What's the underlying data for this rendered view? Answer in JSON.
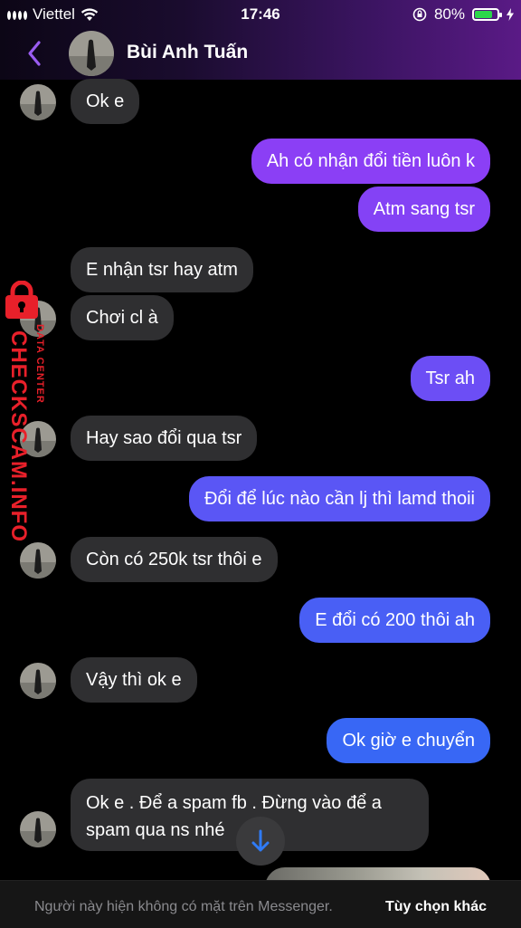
{
  "status_bar": {
    "carrier": "Viettel",
    "time": "17:46",
    "battery_percent": "80%",
    "battery_level": 0.8,
    "battery_color": "#2bd64a"
  },
  "header": {
    "back_icon": "chevron-left-icon",
    "contact_name": "Bùi Anh Tuấn"
  },
  "colors": {
    "incoming_bubble": "#2f2f31",
    "outgoing_gradient_top": "#8b3ff5",
    "outgoing_gradient_bottom": "#2f6bf5",
    "accent": "#9a5cf0"
  },
  "messages": [
    {
      "dir": "in",
      "text": "Ok e"
    },
    {
      "dir": "out",
      "text": "Ah có nhận đổi tiền luôn k"
    },
    {
      "dir": "out",
      "text": "Atm sang tsr"
    },
    {
      "dir": "in",
      "text": "E nhận tsr hay atm"
    },
    {
      "dir": "in",
      "text": "Chơi cl à"
    },
    {
      "dir": "out",
      "text": "Tsr ah"
    },
    {
      "dir": "in",
      "text": "Hay sao đổi qua tsr"
    },
    {
      "dir": "out",
      "text": "Đổi để lúc nào cần lj thì lamd thoii"
    },
    {
      "dir": "in",
      "text": "Còn có 250k tsr thôi e"
    },
    {
      "dir": "out",
      "text": "E đổi có 200 thôi ah"
    },
    {
      "dir": "in",
      "text": "Vậy thì ok e"
    },
    {
      "dir": "out",
      "text": "Ok giờ e chuyển"
    },
    {
      "dir": "in",
      "text": "Ok e . Để   a spam fb .  Đừng vào để a spam qua ns nhé"
    }
  ],
  "watermark": {
    "brand": "CHECKSCAM.INFO",
    "sub": "DATA CENTER"
  },
  "footer": {
    "message": "Người này hiện không có mặt trên Messenger.",
    "option": "Tùy chọn khác"
  }
}
